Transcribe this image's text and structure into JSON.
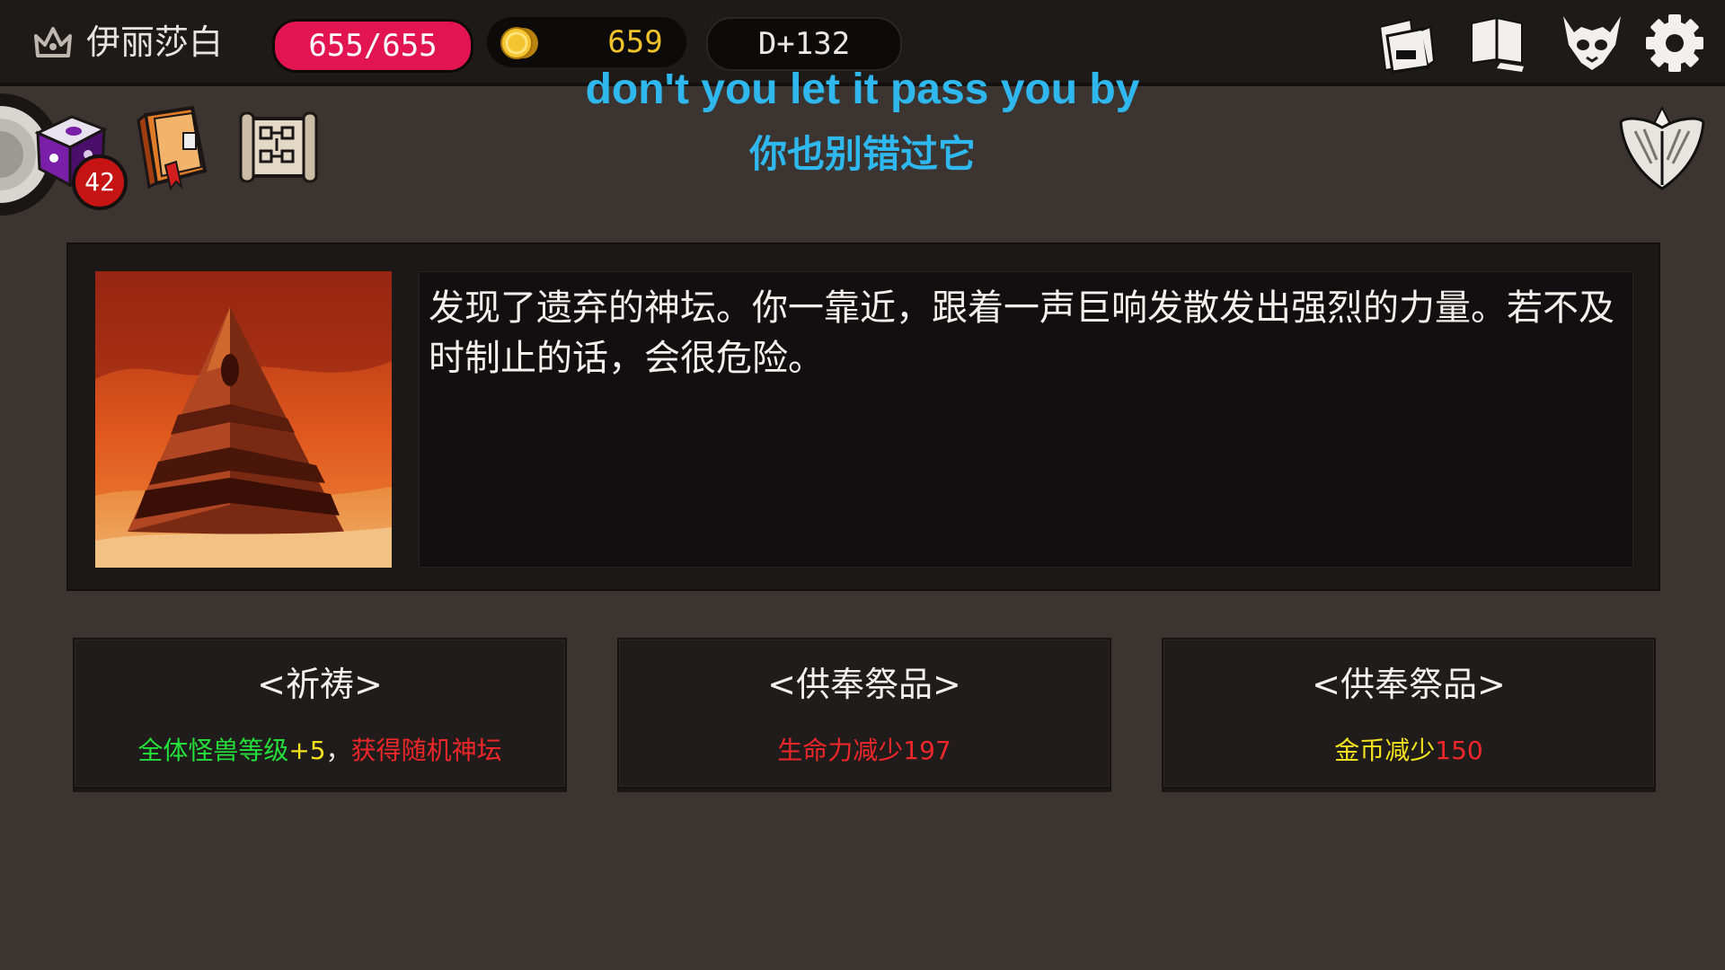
{
  "player": {
    "name": "伊丽莎白",
    "hp": "655/655",
    "gold": "659",
    "day": "D+132"
  },
  "inventory": {
    "dice_count": "42"
  },
  "subtitles": {
    "english": "don't you let it pass you by",
    "chinese": "你也别错过它"
  },
  "event": {
    "description": "发现了遗弃的神坛。你一靠近，跟着一声巨响发散发出强烈的力量。若不及时制止的话，会很危险。"
  },
  "choices": [
    {
      "title": "<祈祷>",
      "effects": [
        "全体怪兽等级",
        "+5",
        "，",
        "获得随机神坛"
      ]
    },
    {
      "title": "<供奉祭品>",
      "effects": [
        "生命力减少",
        "197"
      ]
    },
    {
      "title": "<供奉祭品>",
      "effects": [
        "金币减少",
        "150"
      ]
    }
  ],
  "colors": {
    "hp": "#e21452",
    "gold": "#f3c32c",
    "subtitle": "#2fb8ee",
    "positive": "#24e03a",
    "negative": "#f0272a",
    "cost": "#f3e21d"
  },
  "icons": {
    "top_left": "crown-icon",
    "currency": "coin-icon",
    "top_right": [
      "cards-icon",
      "journal-icon",
      "monster-mask-icon",
      "settings-gear-icon"
    ],
    "inventory": [
      "dice-icon",
      "spellbook-icon",
      "scroll-map-icon"
    ],
    "right": "winged-emblem-icon"
  }
}
